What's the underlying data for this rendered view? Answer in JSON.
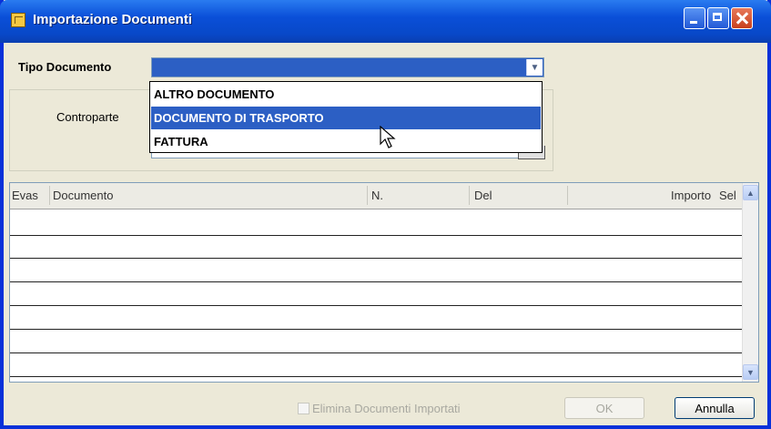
{
  "window": {
    "title": "Importazione Documenti"
  },
  "form": {
    "tipo_label": "Tipo Documento",
    "tipo_value": "",
    "controparte_label": "Controparte"
  },
  "dropdown": {
    "options": [
      "ALTRO DOCUMENTO",
      "DOCUMENTO DI TRASPORTO",
      "FATTURA"
    ],
    "highlighted": "DOCUMENTO DI TRASPORTO"
  },
  "table": {
    "columns": [
      "Evas",
      "Documento",
      "N.",
      "Del",
      "Importo",
      "Sel"
    ],
    "rows": []
  },
  "footer": {
    "checkbox_label": "Elimina Documenti Importati",
    "checkbox_checked": false,
    "ok_label": "OK",
    "cancel_label": "Annulla"
  },
  "icons": [
    "app-icon",
    "minimize-icon",
    "maximize-icon",
    "close-icon",
    "chevron-down-icon",
    "chevron-up-icon",
    "mouse-pointer-icon"
  ],
  "colors": {
    "titlebar": "#0a4fd8",
    "selection": "#2c5fc4",
    "window_bg": "#ece9d8"
  }
}
